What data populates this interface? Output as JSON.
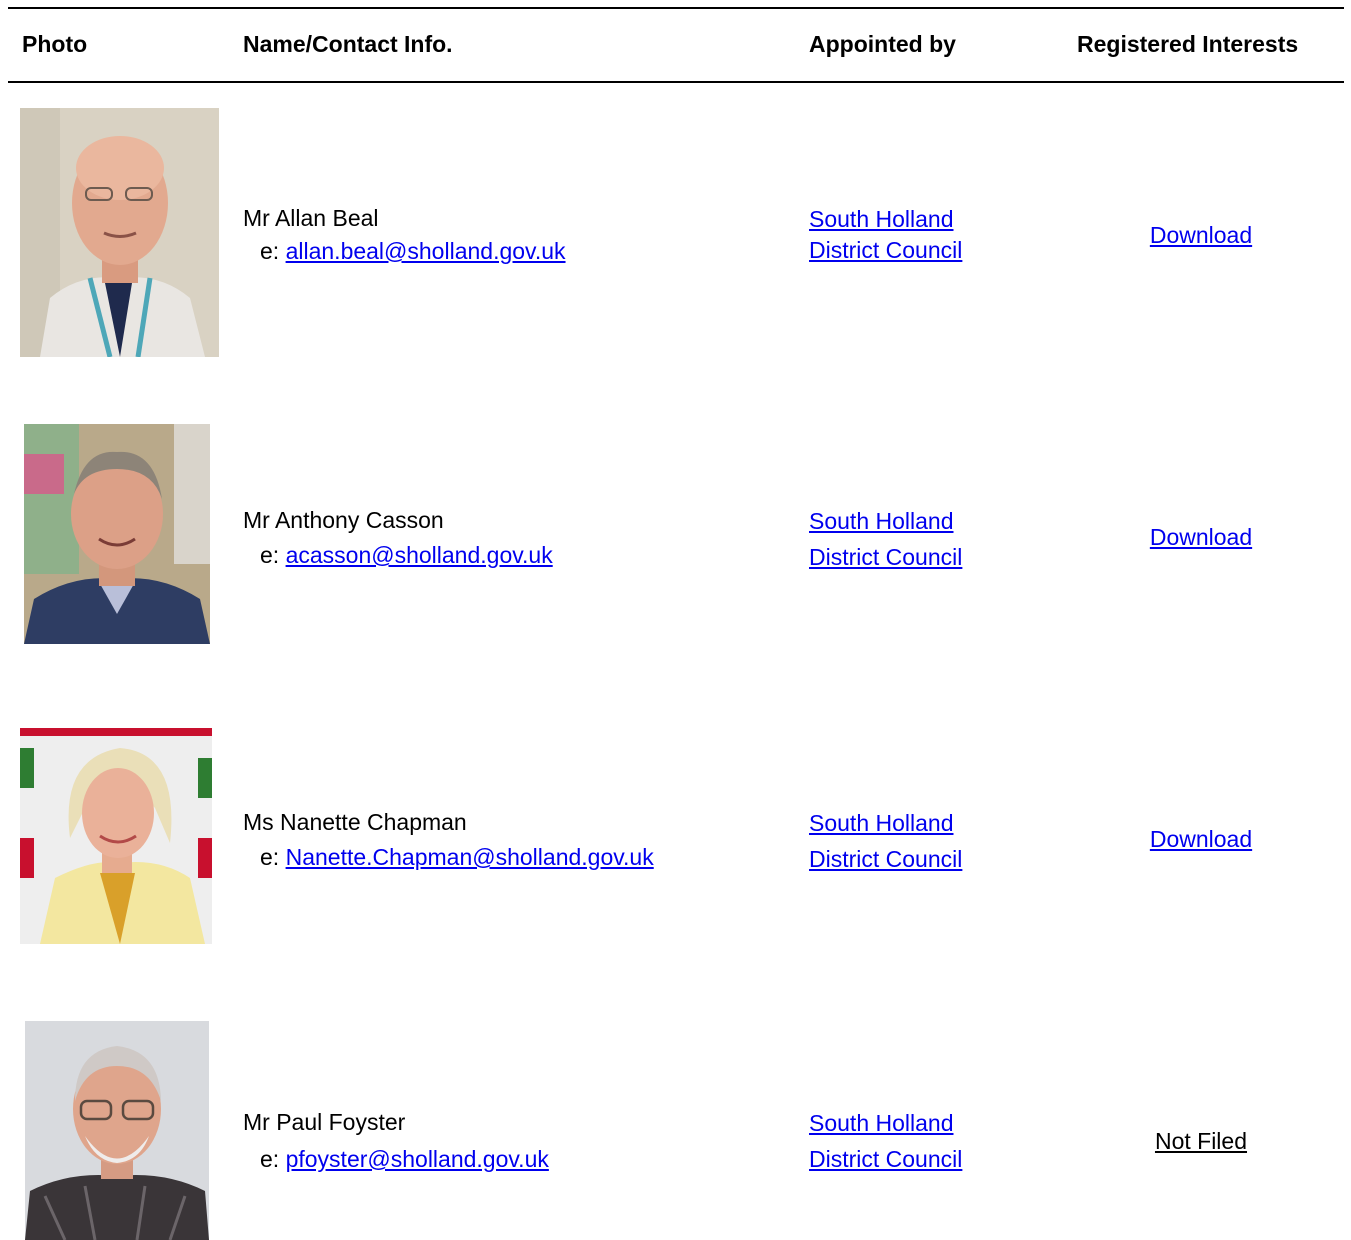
{
  "header": {
    "photo": "Photo",
    "name_contact": "Name/Contact Info.",
    "appointed_by": "Appointed by",
    "registered_interests": "Registered Interests"
  },
  "members": [
    {
      "name": "Mr Allan Beal",
      "email_prefix": "e:",
      "email": "allan.beal@sholland.gov.uk",
      "appointed_line1": "South Holland",
      "appointed_line2": "District Council",
      "interests": "Download"
    },
    {
      "name": "Mr Anthony Casson",
      "email_prefix": "e:",
      "email": "acasson@sholland.gov.uk",
      "appointed_line1": "South Holland",
      "appointed_line2": "District Council",
      "interests": "Download"
    },
    {
      "name": "Ms Nanette Chapman",
      "email_prefix": "e:",
      "email": "Nanette.Chapman@sholland.gov.uk",
      "appointed_line1": "South Holland",
      "appointed_line2": "District Council",
      "interests": "Download"
    },
    {
      "name": "Mr Paul Foyster",
      "email_prefix": "e:",
      "email": "pfoyster@sholland.gov.uk",
      "appointed_line1": "South Holland",
      "appointed_line2": "District Council",
      "interests": "Not Filed"
    }
  ],
  "colors": {
    "link": "#0000ee",
    "text": "#000000",
    "rule": "#000000"
  }
}
